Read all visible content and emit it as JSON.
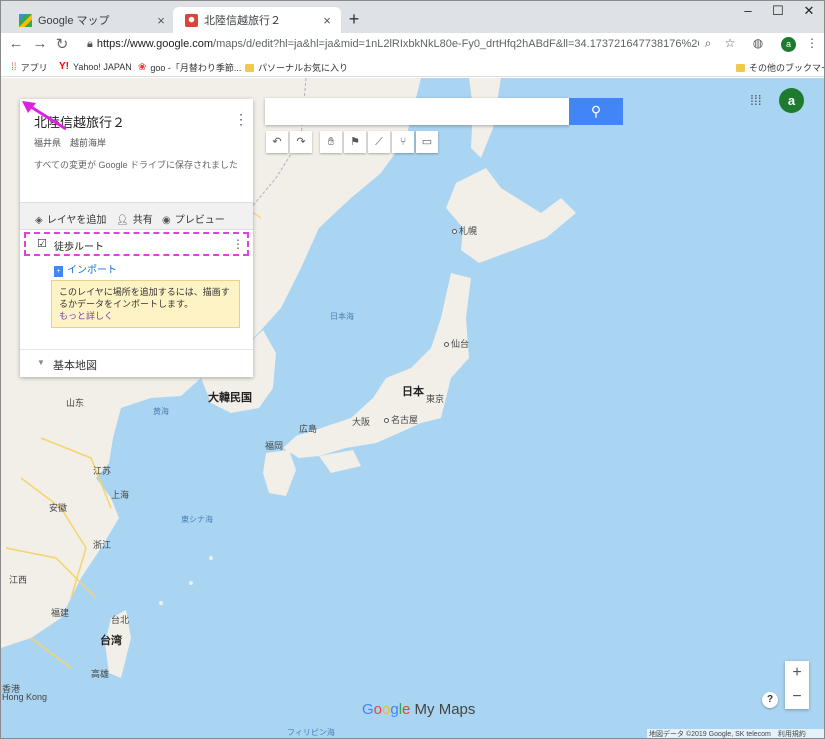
{
  "browser": {
    "tabs": [
      {
        "title": "Google マップ",
        "close": "×"
      },
      {
        "title": "北陸信越旅行２",
        "close": "×"
      }
    ],
    "new_tab": "+",
    "window_controls": {
      "minimize": "–",
      "maximize": "☐",
      "close": "✕"
    },
    "url_host": "https://www.google.com",
    "url_path": "/maps/d/edit?hl=ja&hl=ja&mid=1nL2lRIxbkNkL80e-Fy0_drtHfq2hABdF&ll=34.173721647738176%2C138.450523...",
    "profile_letter": "a",
    "bookmarks": [
      {
        "label": "アプリ",
        "icon": "apps-grid-icon"
      },
      {
        "label": "Yahoo! JAPAN",
        "icon": "yahoo-icon"
      },
      {
        "label": "goo -「月替わり季節...",
        "icon": "goo-icon"
      },
      {
        "label": "パソーナルお気に入り",
        "icon": "folder-icon"
      }
    ],
    "other_bookmarks": "その他のブックマーク"
  },
  "map": {
    "search_placeholder": "",
    "avatar_letter": "a",
    "brand": {
      "google": [
        "G",
        "o",
        "o",
        "g",
        "l",
        "e"
      ],
      "suffix": " My Maps"
    },
    "attribution": "地図データ ©2019 Google, SK telecom　利用規約",
    "zoom_in": "+",
    "zoom_out": "−",
    "help": "?",
    "labels": {
      "sapporo": "札幌",
      "sendai": "仙台",
      "japan": "日本",
      "tokyo": "東京",
      "nagoya": "名古屋",
      "osaka": "大阪",
      "hiroshima": "広島",
      "fukuoka": "福岡",
      "korea": "大韓民国",
      "seoul": "ソウル",
      "sea_of_japan": "日本海",
      "yellow_sea": "黄海",
      "east_china_sea": "東シナ海",
      "shanghai": "上海",
      "jiangsu": "江苏",
      "anhui": "安徽",
      "zhejiang": "浙江",
      "jiangxi": "江西",
      "fujian": "福建",
      "taipei": "台北",
      "taiwan": "台湾",
      "kaohsiung": "高雄",
      "hongkong_cn": "香港",
      "hongkong": "Hong Kong",
      "philippine_sea": "フィリピン海",
      "shandong": "山东"
    }
  },
  "panel": {
    "title": "北陸信越旅行２",
    "description": "福井県　越前海岸",
    "save_note": "すべての変更が Google ドライブに保存されました",
    "add_layer": "レイヤを追加",
    "share": "共有",
    "preview": "プレビュー",
    "layer_name": "徒歩ルート",
    "import": "インポート",
    "tip_text": "このレイヤに場所を追加するには、描画するかデータをインポートします。",
    "tip_link": "もっと詳しく",
    "basemap": "基本地図"
  }
}
